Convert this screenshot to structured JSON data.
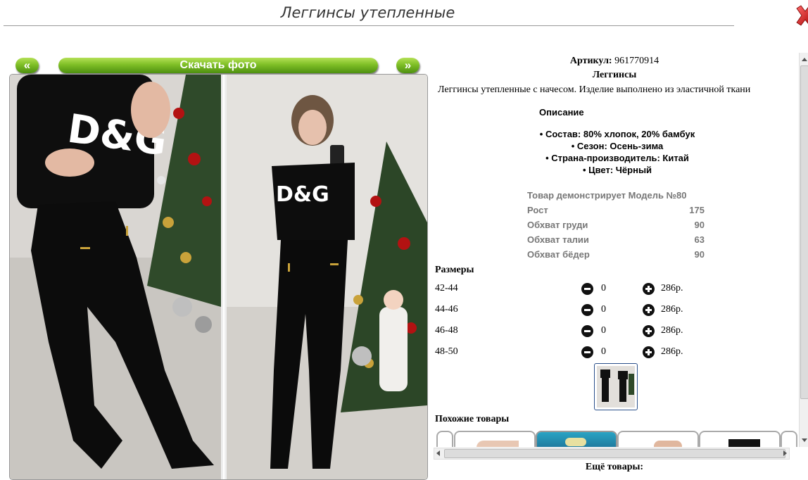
{
  "page": {
    "title": "Леггинсы утепленные"
  },
  "gallery": {
    "prev_label": "«",
    "next_label": "»",
    "download_label": "Скачать фото",
    "print_left": "D&G",
    "print_right": "D&G"
  },
  "product": {
    "article_label": "Артикул:",
    "article_value": "961770914",
    "name": "Леггинсы",
    "short_description": "Леггинсы утепленные с начесом. Изделие выполнено из эластичной ткани",
    "description_heading": "Описание",
    "features": [
      "• Состав: 80% хлопок, 20% бамбук",
      "• Сезон: Осень-зима",
      "• Страна-производитель: Китай",
      "• Цвет: Чёрный"
    ]
  },
  "model": {
    "heading": "Товар демонстрирует Модель №80",
    "rows": [
      {
        "label": "Рост",
        "value": "175"
      },
      {
        "label": "Обхват груди",
        "value": "90"
      },
      {
        "label": "Обхват талии",
        "value": "63"
      },
      {
        "label": "Обхват бёдер",
        "value": "90"
      }
    ]
  },
  "sizes": {
    "heading": "Размеры",
    "rows": [
      {
        "size": "42-44",
        "qty": "0",
        "price": "286р."
      },
      {
        "size": "44-46",
        "qty": "0",
        "price": "286р."
      },
      {
        "size": "46-48",
        "qty": "0",
        "price": "286р."
      },
      {
        "size": "48-50",
        "qty": "0",
        "price": "286р."
      }
    ]
  },
  "similar": {
    "heading": "Похожие товары"
  },
  "more": {
    "heading": "Ещё товары:"
  },
  "colors": {
    "accent_green": "#7fbf26",
    "close_red": "#cc2222",
    "model_text": "#777777"
  },
  "icons": [
    "close-icon",
    "minus-icon",
    "plus-icon"
  ]
}
